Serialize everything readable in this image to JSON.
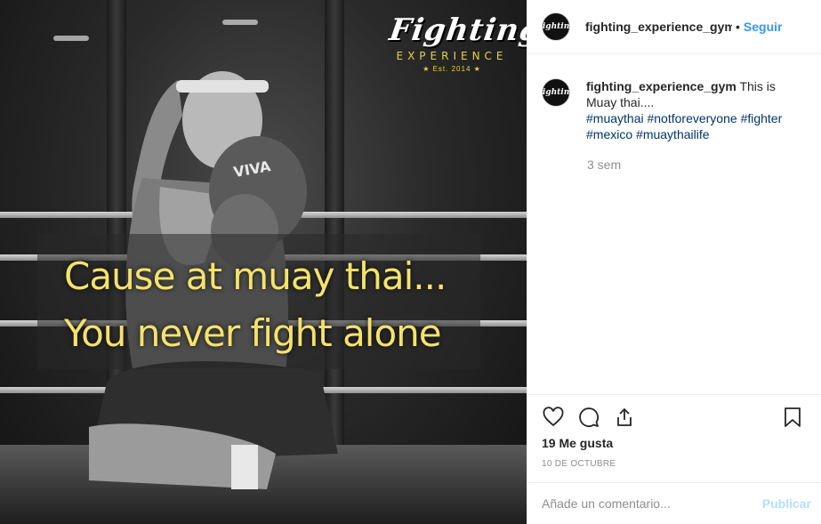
{
  "media": {
    "caption_line1": "Cause at muay thai...",
    "caption_line2": "You never fight alone",
    "brand_script": "Fighting",
    "brand_sub": "EXPERIENCE",
    "brand_est": "★ Est. 2014 ★",
    "glove_text": "VIVA"
  },
  "header": {
    "username": "fighting_experience_gym",
    "separator": "•",
    "follow_label": "Seguir"
  },
  "caption": {
    "username": "fighting_experience_gym",
    "text": "This is Muay thai....",
    "hashtags": [
      "#muaythai",
      "#notforeveryone",
      "#fighter",
      "#mexico",
      "#muaythailife"
    ],
    "time": "3 sem"
  },
  "actions": {
    "icons": [
      "heart-icon",
      "comment-icon",
      "share-icon",
      "bookmark-icon"
    ],
    "likes": "19 Me gusta",
    "date": "10 DE OCTUBRE"
  },
  "comment_box": {
    "placeholder": "Añade un comentario...",
    "publish_label": "Publicar"
  },
  "colors": {
    "accent": "#3897f0",
    "hashtag": "#003569",
    "publish_disabled": "#b2dffc",
    "caption_yellow": "#f5e26a"
  }
}
